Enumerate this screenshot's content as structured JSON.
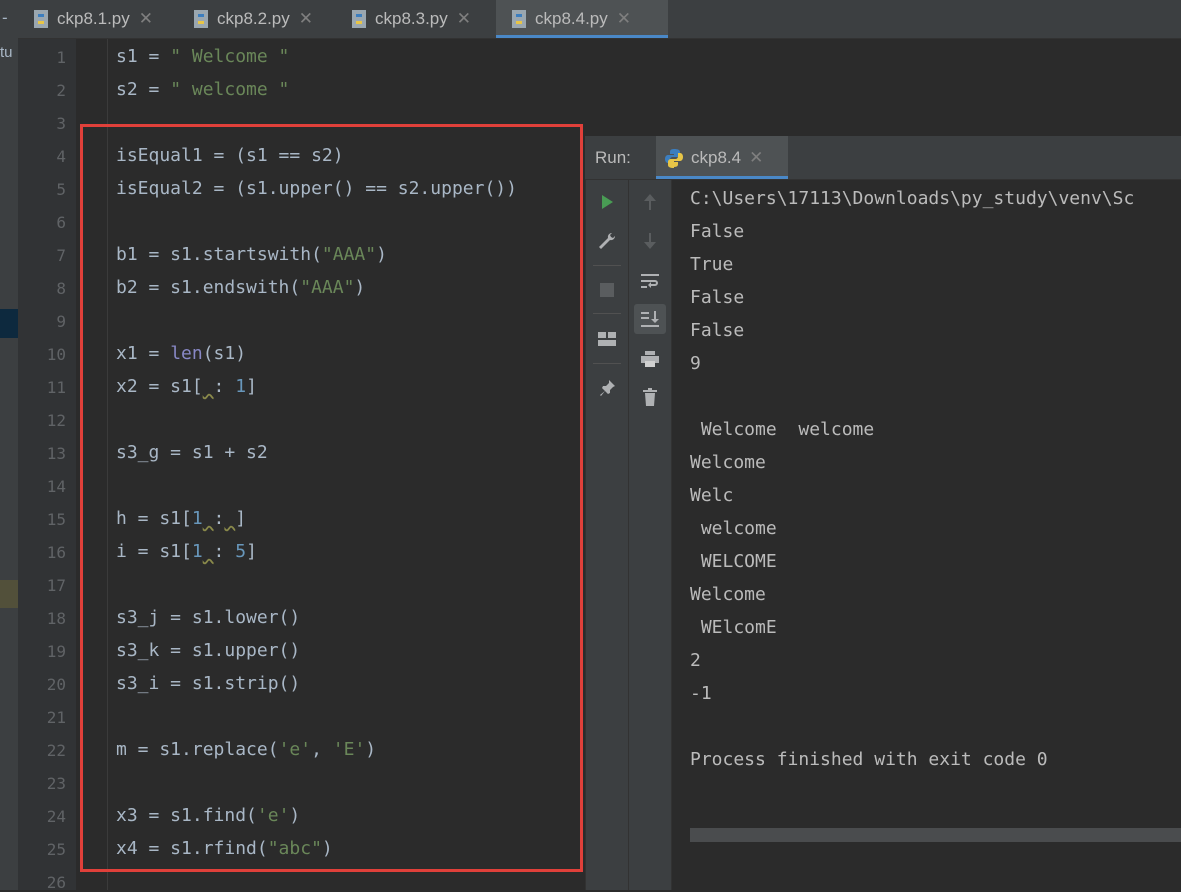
{
  "left_strip": {
    "fragment": "tu",
    "dash": "-"
  },
  "tabs": [
    {
      "label": "ckp8.1.py",
      "close": "✕"
    },
    {
      "label": "ckp8.2.py",
      "close": "✕"
    },
    {
      "label": "ckp8.3.py",
      "close": "✕"
    },
    {
      "label": "ckp8.4.py",
      "close": "✕",
      "active": true
    }
  ],
  "editor": {
    "line_numbers": [
      "1",
      "2",
      "3",
      "4",
      "5",
      "6",
      "7",
      "8",
      "9",
      "10",
      "11",
      "12",
      "13",
      "14",
      "15",
      "16",
      "17",
      "18",
      "19",
      "20",
      "21",
      "22",
      "23",
      "24",
      "25",
      "26"
    ],
    "code": {
      "l1": {
        "a": "s1 = ",
        "b": "\" Welcome \""
      },
      "l2": {
        "a": "s2 = ",
        "b": "\" welcome \""
      },
      "l4": "isEqual1 = (s1 == s2)",
      "l5": "isEqual2 = (s1.upper() == s2.upper())",
      "l7": {
        "a": "b1 = s1.startswith(",
        "b": "\"AAA\"",
        "c": ")"
      },
      "l8": {
        "a": "b2 = s1.endswith(",
        "b": "\"AAA\"",
        "c": ")"
      },
      "l10": {
        "a": "x1 = ",
        "b": "len",
        "c": "(s1)"
      },
      "l11": {
        "a": "x2 = s1[",
        "b": " ",
        "c": ": ",
        "d": "1",
        "e": "]"
      },
      "l13": "s3_g = s1 + s2",
      "l15": {
        "a": "h = s1[",
        "b": "1",
        "c": " ",
        "d": ":",
        "e": " ",
        "f": "]"
      },
      "l16": {
        "a": "i = s1[",
        "b": "1",
        "c": " ",
        "d": ": ",
        "e": "5",
        "f": "]"
      },
      "l18": "s3_j = s1.lower()",
      "l19": "s3_k = s1.upper()",
      "l20": "s3_i = s1.strip()",
      "l22": {
        "a": "m = s1.replace(",
        "b": "'e'",
        "c": ", ",
        "d": "'E'",
        "e": ")"
      },
      "l24": {
        "a": "x3 = s1.find(",
        "b": "'e'",
        "c": ")"
      },
      "l25": {
        "a": "x4 = s1.rfind(",
        "b": "\"abc\"",
        "c": ")"
      }
    }
  },
  "run": {
    "label": "Run:",
    "tab_label": "ckp8.4",
    "tab_close": "✕",
    "output": [
      "C:\\Users\\17113\\Downloads\\py_study\\venv\\Sc",
      "False",
      "True",
      "False",
      "False",
      "9",
      "",
      " Welcome  welcome",
      "Welcome",
      "Welc",
      " welcome",
      " WELCOME",
      "Welcome",
      " WElcomE",
      "2",
      "-1",
      "",
      "Process finished with exit code 0"
    ]
  },
  "colors": {
    "accent": "#4a88c7",
    "highlight_border": "#e0403a",
    "string": "#6a8759",
    "number": "#6897bb",
    "builtin": "#8888c6",
    "run_green": "#499c54"
  }
}
